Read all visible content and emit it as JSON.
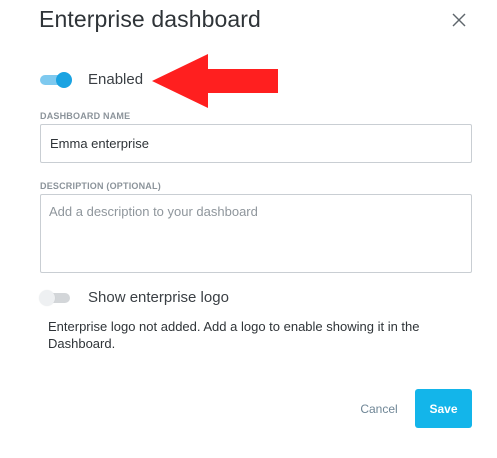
{
  "dialog": {
    "title": "Enterprise dashboard",
    "close_icon": "close-icon"
  },
  "enabled_toggle": {
    "label": "Enabled",
    "on": true,
    "accent_color": "#1aa3e2"
  },
  "annotation": {
    "arrow_icon": "red-arrow-left-icon",
    "color": "#ff1f1f"
  },
  "dashboard_name": {
    "label": "DASHBOARD NAME",
    "value": "Emma enterprise"
  },
  "description": {
    "label": "DESCRIPTION (OPTIONAL)",
    "value": "",
    "placeholder": "Add a description to your dashboard"
  },
  "logo_toggle": {
    "label": "Show enterprise logo",
    "on": false,
    "help_text": "Enterprise logo not added. Add a logo to enable showing it in the Dashboard."
  },
  "actions": {
    "cancel_label": "Cancel",
    "save_label": "Save",
    "save_color": "#13b5ea"
  }
}
